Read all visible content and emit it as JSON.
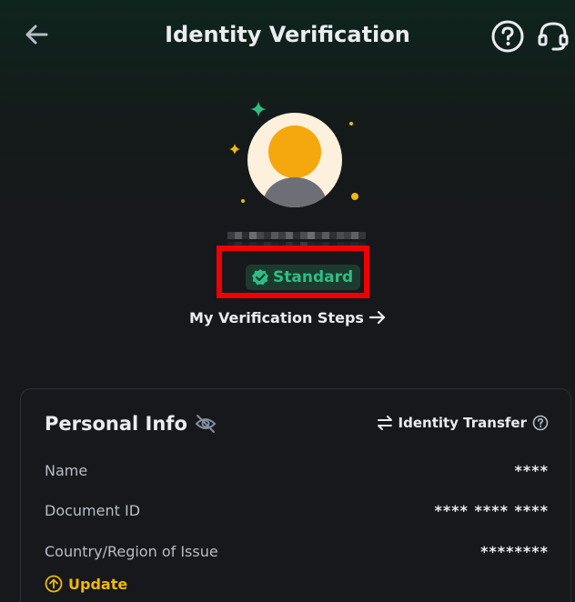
{
  "header": {
    "title": "Identity Verification",
    "back_icon": "back-arrow-icon",
    "help_icon": "help-circle-icon",
    "support_icon": "headset-icon"
  },
  "profile": {
    "avatar_icon": "user-avatar-icon",
    "badge_label": "Standard",
    "badge_icon": "verified-check-icon",
    "steps_link_label": "My Verification Steps",
    "steps_link_icon": "arrow-right-icon"
  },
  "personal_info": {
    "title": "Personal Info",
    "visibility_icon": "eye-off-icon",
    "transfer_label": "Identity Transfer",
    "transfer_icon": "swap-icon",
    "transfer_help_icon": "help-circle-icon",
    "rows": [
      {
        "label": "Name",
        "value": "****"
      },
      {
        "label": "Document ID",
        "value": "**** **** ****"
      },
      {
        "label": "Country/Region of Issue",
        "value": "********"
      }
    ],
    "update_label": "Update",
    "update_icon": "arrow-up-circle-icon"
  },
  "colors": {
    "accent_green": "#2ebd85",
    "accent_yellow": "#f0b90b",
    "highlight_red": "#f00000",
    "background": "#17181c"
  }
}
